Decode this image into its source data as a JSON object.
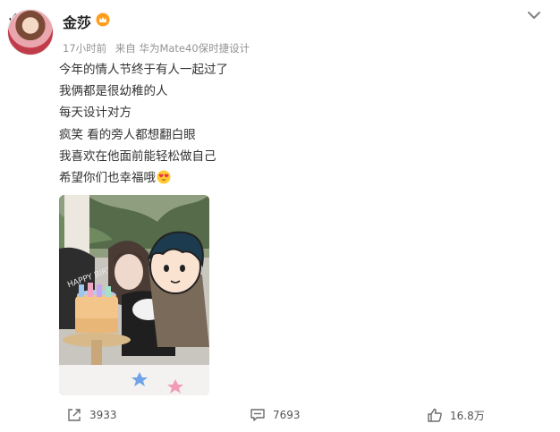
{
  "post": {
    "author": "金莎",
    "time": "17小时前",
    "source": "来自 华为Mate40保时捷设计",
    "lines": [
      "今年的情人节终于有人一起过了",
      "我俩都是很幼稚的人",
      "每天设计对方",
      "疯笑 看的旁人都想翻白眼",
      "我喜欢在他面前能轻松做自己",
      "希望你们也幸福哦"
    ],
    "emoji_name": "heart-eyes-icon",
    "image_alt": "生日蛋糕合照"
  },
  "actions": {
    "repost_count": "3933",
    "comment_count": "7693",
    "like_count": "16.8万"
  },
  "colors": {
    "accent": "#f7b500",
    "meta": "#939393",
    "text": "#333333"
  }
}
